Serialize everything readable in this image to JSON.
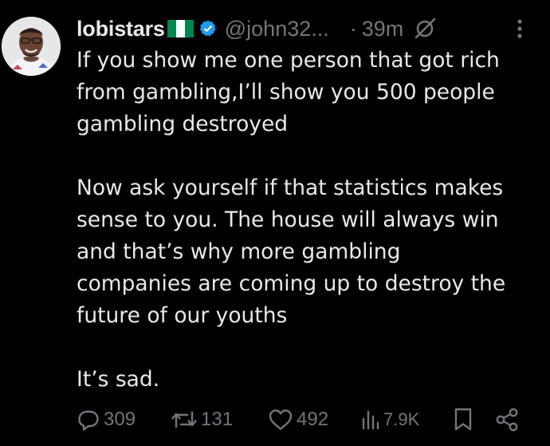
{
  "author": {
    "display_name": "lobistars",
    "handle": "@john32...",
    "time_separator": "·",
    "time_ago": "39m"
  },
  "tweet": {
    "paragraphs": [
      [
        "If you show me one person that got rich",
        "from gambling,I’ll show you 500 people",
        "gambling destroyed"
      ],
      [
        "Now ask yourself if that statistics makes",
        "sense to you. The house will always win",
        "and that’s why more gambling",
        "companies are coming up to destroy the",
        "future of our youths"
      ],
      [
        "It’s sad."
      ]
    ]
  },
  "metrics": {
    "replies": "309",
    "reposts": "131",
    "likes": "492",
    "views": "7.9K"
  },
  "icons": {
    "flag": "nigeria-flag-icon",
    "verified": "verified-badge-icon",
    "grok": "grok-icon",
    "more": "more-options-icon",
    "reply": "reply-icon",
    "repost": "repost-icon",
    "like": "like-icon",
    "views": "views-icon",
    "bookmark": "bookmark-icon",
    "share": "share-icon"
  },
  "colors": {
    "background": "#000000",
    "text_primary": "#e7e9ea",
    "text_secondary": "#71767b",
    "verified_blue": "#1d9bf0",
    "flag_green": "#008751",
    "flag_white": "#ffffff"
  }
}
